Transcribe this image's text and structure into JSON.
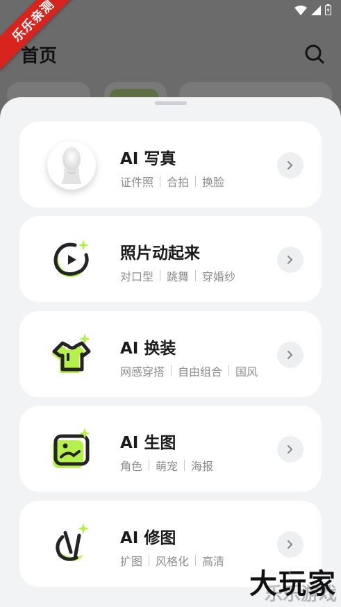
{
  "header": {
    "title": "首页"
  },
  "banner": {
    "text": "乐乐亲测"
  },
  "cards": [
    {
      "title": "AI 写真",
      "tags": [
        "证件照",
        "合拍",
        "换脸"
      ],
      "icon": "portrait-icon"
    },
    {
      "title": "照片动起来",
      "tags": [
        "对口型",
        "跳舞",
        "穿婚纱"
      ],
      "icon": "play-photo-icon"
    },
    {
      "title": "AI 换装",
      "tags": [
        "网感穿搭",
        "自由组合",
        "国风"
      ],
      "icon": "tshirt-icon"
    },
    {
      "title": "AI 生图",
      "tags": [
        "角色",
        "萌宠",
        "海报"
      ],
      "icon": "image-gen-icon"
    },
    {
      "title": "AI 修图",
      "tags": [
        "扩图",
        "风格化",
        "高清"
      ],
      "icon": "retouch-icon"
    }
  ],
  "watermark": {
    "text": "大玩家",
    "sub": "乐乐游戏"
  },
  "colors": {
    "accent_green": "#b6f04a",
    "icon_dark": "#242424",
    "sheet_bg": "#f2f3f5"
  }
}
